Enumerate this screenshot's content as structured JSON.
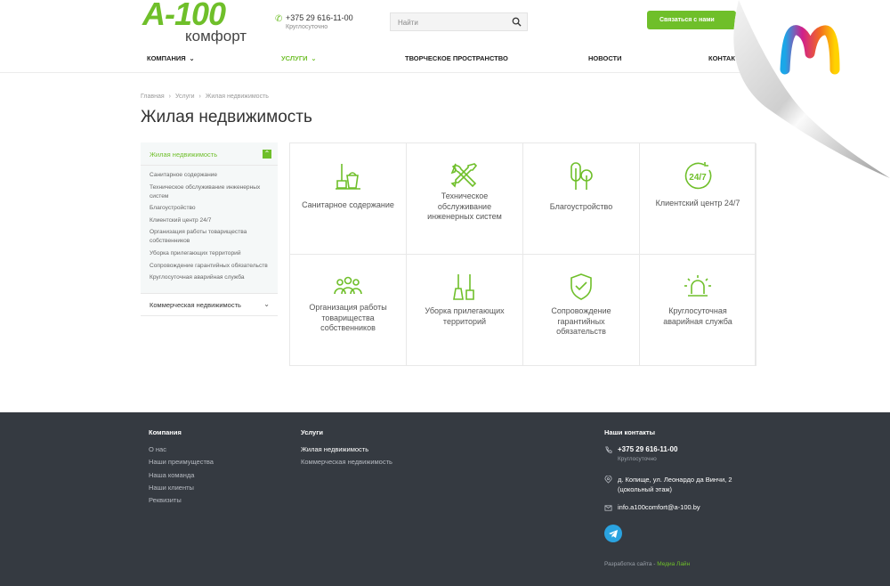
{
  "brand": {
    "logo_main": "A-100",
    "logo_sub": "комфорт",
    "accent": "#6fbf2a"
  },
  "contact": {
    "phone": "+375 29 616-11-00",
    "hours": "Круглосуточно"
  },
  "search": {
    "placeholder": "Найти"
  },
  "cta": {
    "label": "Связаться с нами"
  },
  "nav": [
    {
      "label": "Компания",
      "has_dropdown": true
    },
    {
      "label": "Услуги",
      "has_dropdown": true,
      "active": true
    },
    {
      "label": "Творческое пространство"
    },
    {
      "label": "Новости"
    },
    {
      "label": "Контакты"
    }
  ],
  "breadcrumb": [
    "Главная",
    "Услуги",
    "Жилая недвижимость"
  ],
  "page_title": "Жилая недвижимость",
  "sidebar": {
    "section_label": "Жилая недвижимость",
    "items": [
      "Санитарное содержание",
      "Техническое обслуживание инженерных систем",
      "Благоустройство",
      "Клиентский центр 24/7",
      "Организация работы товарищества собственников",
      "Уборка прилегающих территорий",
      "Сопровождение гарантийных обязательств",
      "Круглосуточная аварийная служба"
    ],
    "other_section": "Коммерческая недвижимость"
  },
  "services": [
    {
      "label": "Санитарное содержание",
      "icon": "mop-bucket-icon"
    },
    {
      "label": "Техническое обслуживание инженерных систем",
      "icon": "wrench-screwdriver-icon"
    },
    {
      "label": "Благоустройство",
      "icon": "trees-icon"
    },
    {
      "label": "Клиентский центр 24/7",
      "icon": "clock-24-7-icon"
    },
    {
      "label": "Организация работы товарищества собственников",
      "icon": "people-group-icon"
    },
    {
      "label": "Уборка прилегающих территорий",
      "icon": "broom-icon"
    },
    {
      "label": "Сопровождение гарантийных обязательств",
      "icon": "shield-check-icon"
    },
    {
      "label": "Круглосуточная аварийная служба",
      "icon": "alarm-beacon-icon"
    }
  ],
  "footer": {
    "company": {
      "title": "Компания",
      "links": [
        "О нас",
        "Наши преимущества",
        "Наша команда",
        "Наши клиенты",
        "Реквизиты"
      ]
    },
    "services": {
      "title": "Услуги",
      "links": [
        "Жилая недвижимость",
        "Коммерческая недвижимость"
      ]
    },
    "contacts": {
      "title": "Наши контакты",
      "phone": "+375 29 616-11-00",
      "hours": "Круглосуточно",
      "address": "д. Копище, ул. Леонардо да Винчи, 2 (цокольный этаж)",
      "email": "info.a100comfort@a-100.by"
    },
    "dev_prefix": "Разработка сайта -",
    "dev_name": "Медиа Лайн"
  }
}
